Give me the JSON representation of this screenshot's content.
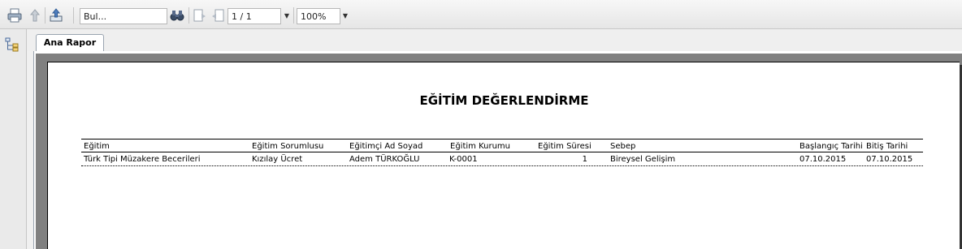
{
  "toolbar": {
    "search_value": "Bul...",
    "page_value": "1 / 1",
    "zoom_value": "100%",
    "icons": [
      "print-icon",
      "up-arrow-icon",
      "export-icon",
      "binoculars-icon",
      "next-page-icon",
      "prev-page-icon"
    ]
  },
  "tabs": [
    {
      "label": "Ana Rapor",
      "active": true
    }
  ],
  "report": {
    "title": "EĞİTİM DEĞERLENDİRME",
    "columns": {
      "egitim": "Eğitim",
      "sorumlu": "Eğitim Sorumlusu",
      "egitimci": "Eğitimçi Ad Soyad",
      "kurum": "Eğitim Kurumu",
      "sure": "Eğitim Süresi",
      "sebep": "Sebep",
      "baslangic": "Başlangıç Tarihi",
      "bitis": "Bitiş Tarihi"
    },
    "rows": [
      {
        "egitim": "Türk Tipi Müzakere Becerileri",
        "sorumlu": "Kızılay Ücret",
        "egitimci": "Adem TÜRKOĞLU",
        "kurum": "K-0001",
        "sure": "1",
        "sebep": "Bireysel Gelişim",
        "baslangic": "07.10.2015",
        "bitis": "07.10.2015"
      }
    ]
  },
  "colors": {
    "report_background": "#808080",
    "page": "#ffffff",
    "toolbar": "#eeeeee"
  }
}
